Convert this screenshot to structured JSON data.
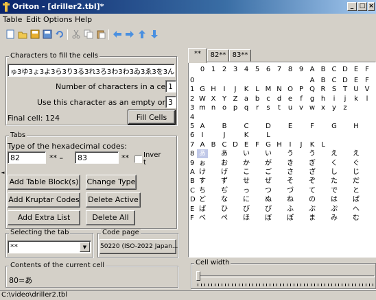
{
  "window": {
    "title": "Oriton - [driller2.tbl]*"
  },
  "menu": [
    "Table",
    "Edit",
    "Options",
    "Help"
  ],
  "fill": {
    "group_title": "Characters to fill the cells",
    "chars_value": "ゅ3ゆ3ょ3よ3ら3り3る3れ3ろ3わ3わ3ゐ3ゑ3を3ん",
    "num_chars_label": "Number of characters in a cell:",
    "num_chars_value": "1",
    "empty_char_label": "Use this character as an empty one:",
    "empty_char_value": "3",
    "final_cell_label": "Final cell: 124",
    "fill_button": "Fill Cells"
  },
  "tabs_group": {
    "title": "Tabs",
    "hex_label": "Type of the hexadecimal codes:",
    "from_value": "82",
    "from_suffix": "** –",
    "to_value": "83",
    "to_suffix": "**",
    "invert_label_1": "Inver",
    "invert_label_2": "t",
    "add_table_block": "Add Table Block(s)",
    "change_type": "Change Type",
    "add_kruptar": "Add Kruptar Codes",
    "delete_active": "Delete Active",
    "add_extra": "Add Extra List",
    "delete_all": "Delete All"
  },
  "selecting_tab": {
    "title": "Selecting the tab",
    "value": "**"
  },
  "code_page": {
    "title": "Code page",
    "button": "50220 (ISO-2022 Japan..."
  },
  "contents": {
    "title": "Contents of the current cell",
    "value": "80=あ"
  },
  "cell_width": {
    "title": "Cell width"
  },
  "table": {
    "tabs": [
      "**",
      "82**",
      "83**"
    ],
    "col_headers": [
      "0",
      "1",
      "2",
      "3",
      "4",
      "5",
      "6",
      "7",
      "8",
      "9",
      "A",
      "B",
      "C",
      "D",
      "E",
      "F"
    ],
    "row_headers": [
      "0",
      "1",
      "2",
      "3",
      "4",
      "5",
      "6",
      "7",
      "8",
      "9",
      "A",
      "B",
      "C",
      "D",
      "E",
      "F"
    ],
    "rows": [
      [
        "",
        "",
        "",
        "",
        "",
        "",
        "",
        "",
        "",
        "",
        "A",
        "B",
        "C",
        "D",
        "E",
        "F"
      ],
      [
        "G",
        "H",
        "I",
        "J",
        "K",
        "L",
        "M",
        "N",
        "O",
        "P",
        "Q",
        "R",
        "S",
        "T",
        "U",
        "V"
      ],
      [
        "W",
        "X",
        "Y",
        "Z",
        "a",
        "b",
        "c",
        "d",
        "e",
        "f",
        "g",
        "h",
        "i",
        "j",
        "k",
        "l"
      ],
      [
        "m",
        "n",
        "o",
        "p",
        "q",
        "r",
        "s",
        "t",
        "u",
        "v",
        "w",
        "x",
        "y",
        "z",
        "",
        ""
      ],
      [
        "",
        "",
        "",
        "",
        "",
        "",
        "",
        "",
        "",
        "",
        "",
        "",
        "",
        "",
        "",
        ""
      ],
      [
        "A",
        "",
        "B",
        "",
        "C",
        "",
        "D",
        "",
        "E",
        "",
        "F",
        "",
        "G",
        "",
        "H",
        ""
      ],
      [
        "I",
        "",
        "J",
        "",
        "K",
        "",
        "L",
        "",
        "",
        "",
        "",
        "",
        "",
        "",
        "",
        ""
      ],
      [
        "A",
        "B",
        "C",
        "D",
        "E",
        "F",
        "G",
        "H",
        "I",
        "J",
        "K",
        "L",
        "",
        "",
        "",
        ""
      ],
      [
        "あ",
        "",
        "あ",
        "",
        "い",
        "",
        "い",
        "",
        "う",
        "",
        "う",
        "",
        "え",
        "",
        "え",
        ""
      ],
      [
        "ぉ",
        "",
        "お",
        "",
        "か",
        "",
        "が",
        "",
        "き",
        "",
        "ぎ",
        "",
        "く",
        "",
        "ぐ",
        ""
      ],
      [
        "け",
        "",
        "げ",
        "",
        "こ",
        "",
        "ご",
        "",
        "さ",
        "",
        "ざ",
        "",
        "し",
        "",
        "じ",
        ""
      ],
      [
        "す",
        "",
        "ず",
        "",
        "せ",
        "",
        "ぜ",
        "",
        "そ",
        "",
        "ぞ",
        "",
        "た",
        "",
        "だ",
        ""
      ],
      [
        "ち",
        "",
        "ぢ",
        "",
        "っ",
        "",
        "つ",
        "",
        "づ",
        "",
        "て",
        "",
        "で",
        "",
        "と",
        ""
      ],
      [
        "ど",
        "",
        "な",
        "",
        "に",
        "",
        "ぬ",
        "",
        "ね",
        "",
        "の",
        "",
        "は",
        "",
        "ば",
        ""
      ],
      [
        "ぱ",
        "",
        "ひ",
        "",
        "び",
        "",
        "ぴ",
        "",
        "ふ",
        "",
        "ぶ",
        "",
        "ぷ",
        "",
        "へ",
        ""
      ],
      [
        "べ",
        "",
        "ぺ",
        "",
        "ほ",
        "",
        "ぼ",
        "",
        "ぽ",
        "",
        "ま",
        "",
        "み",
        "",
        "む",
        ""
      ]
    ]
  },
  "status": {
    "path": "C:\\video\\driller2.tbl"
  }
}
